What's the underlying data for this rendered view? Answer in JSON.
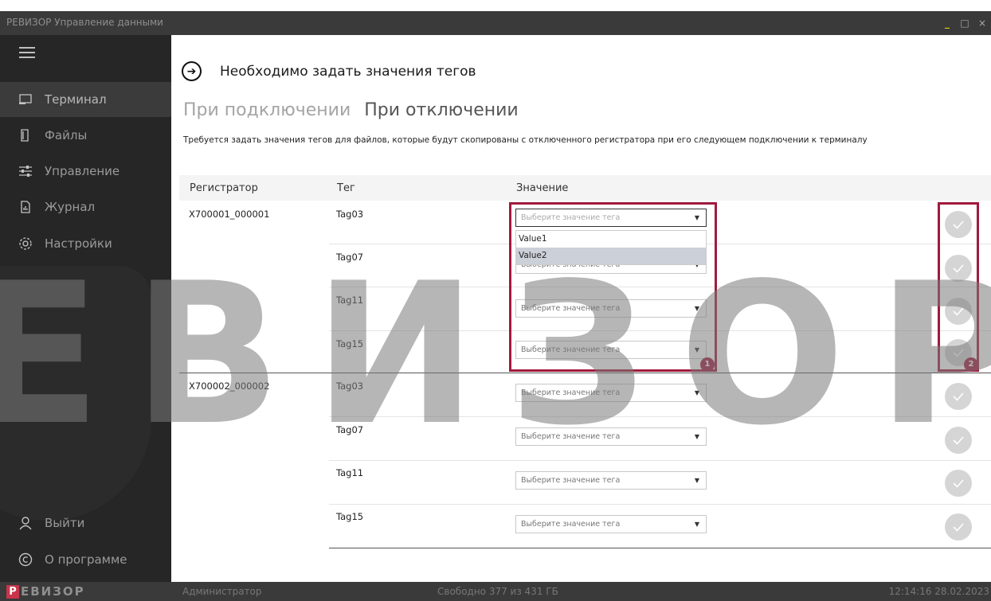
{
  "window": {
    "title": "РЕВИЗОР Управление данными",
    "minimize": "_",
    "maximize": "□",
    "close": "×"
  },
  "sidebar": {
    "items": [
      {
        "label": "Терминал",
        "icon": "terminal-icon",
        "active": true
      },
      {
        "label": "Файлы",
        "icon": "files-icon"
      },
      {
        "label": "Управление",
        "icon": "sliders-icon"
      },
      {
        "label": "Журнал",
        "icon": "journal-icon"
      },
      {
        "label": "Настройки",
        "icon": "gear-icon"
      }
    ],
    "logout": {
      "label": "Выйти",
      "icon": "user-icon"
    },
    "about": {
      "label": "О программе",
      "icon": "copyright-icon"
    }
  },
  "main": {
    "heading": "Необходимо задать значения тегов",
    "tabs": {
      "on_connect": "При подключении",
      "on_disconnect": "При отключении"
    },
    "description": "Требуется задать значения тегов для файлов, которые будут скопированы с отключенного регистратора при его следующем подключении к терминалу",
    "columns": {
      "registrar": "Регистратор",
      "tag": "Тег",
      "value": "Значение"
    },
    "placeholder": "Выберите значение тега",
    "groups": [
      {
        "registrar": "X700001_000001",
        "tags": [
          "Tag03",
          "Tag07",
          "Tag11",
          "Tag15"
        ]
      },
      {
        "registrar": "X700002_000002",
        "tags": [
          "Tag03",
          "Tag07",
          "Tag11",
          "Tag15"
        ]
      }
    ],
    "dropdown_options": [
      "Value1",
      "Value2"
    ],
    "highlighted_option": "Value2",
    "annotations": [
      "1",
      "2"
    ]
  },
  "watermark": {
    "text": "ЕВИЗОР"
  },
  "status": {
    "logo_letter": "Р",
    "logo_rest": "ЕВИЗОР",
    "user": "Администратор",
    "free_space": "Свободно 377 из 431 ГБ",
    "datetime": "12:14:16 28.02.2023"
  },
  "colors": {
    "accent": "#a11a3d",
    "sidebar_bg": "#262626",
    "titlebar_bg": "#3a3a3a"
  }
}
